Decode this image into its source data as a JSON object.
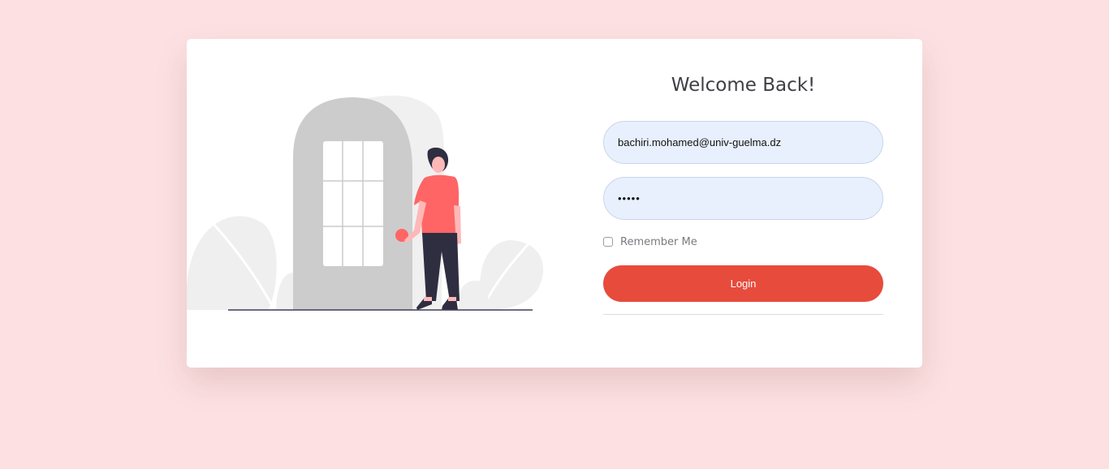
{
  "login": {
    "title": "Welcome Back!",
    "email_value": "bachiri.mohamed@univ-guelma.dz",
    "password_value": "•••••",
    "remember_label": "Remember Me",
    "remember_checked": false,
    "button_label": "Login"
  },
  "colors": {
    "page_background": "#fde1e2",
    "card_background": "#ffffff",
    "input_background": "#e8f0fe",
    "button_background": "#e74b3c",
    "accent": "#ff6565"
  }
}
